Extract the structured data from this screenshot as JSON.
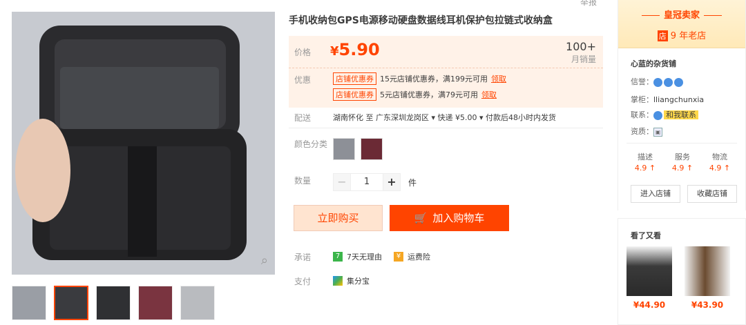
{
  "top_note": "举报",
  "title": "手机收纳包GPS电源移动硬盘数据线耳机保护包拉链式收纳盒",
  "price": {
    "label": "价格",
    "currency": "¥",
    "value": "5.90"
  },
  "sales": {
    "count": "100+",
    "label": "月销量"
  },
  "promo": {
    "label": "优惠",
    "items": [
      {
        "tag": "店铺优惠券",
        "text": "15元店铺优惠券，满199元可用",
        "claim": "领取"
      },
      {
        "tag": "店铺优惠券",
        "text": "5元店铺优惠券，满79元可用",
        "claim": "领取"
      }
    ]
  },
  "shipping": {
    "label": "配送",
    "text": "湖南怀化 至  广东深圳龙岗区 ▾   快递 ¥5.00 ▾   付款后48小时内发货"
  },
  "color": {
    "label": "颜色分类"
  },
  "quantity": {
    "label": "数量",
    "minus": "−",
    "value": "1",
    "plus": "+",
    "unit": "件"
  },
  "buttons": {
    "buy": "立即购买",
    "cart": "加入购物车",
    "cart_icon": "cart-icon"
  },
  "promise": {
    "label": "承诺",
    "icon": "7",
    "text": "7天无理由",
    "insurance": "运费险"
  },
  "pay": {
    "label": "支付",
    "text": "集分宝"
  },
  "shop": {
    "crown": "皇冠卖家",
    "store_badge": "店",
    "years": "9 年老店",
    "name": "心蓝的杂货铺",
    "credit_label": "信誉：",
    "keeper_label": "掌柜：",
    "keeper": "lliangchunxia",
    "contact_label": "联系：",
    "contact": "和我联系",
    "qual_label": "资质：",
    "scores": [
      {
        "title": "描述",
        "score": "4.9 ↑"
      },
      {
        "title": "服务",
        "score": "4.9 ↑"
      },
      {
        "title": "物流",
        "score": "4.9 ↑"
      }
    ],
    "enter": "进入店铺",
    "favorite": "收藏店铺"
  },
  "also_viewed": {
    "title": "看了又看",
    "items": [
      {
        "price": "¥44.90"
      },
      {
        "price": "¥43.90"
      }
    ]
  },
  "colors": {
    "accent": "#ff4400",
    "price_bg": "#fff2e8"
  }
}
